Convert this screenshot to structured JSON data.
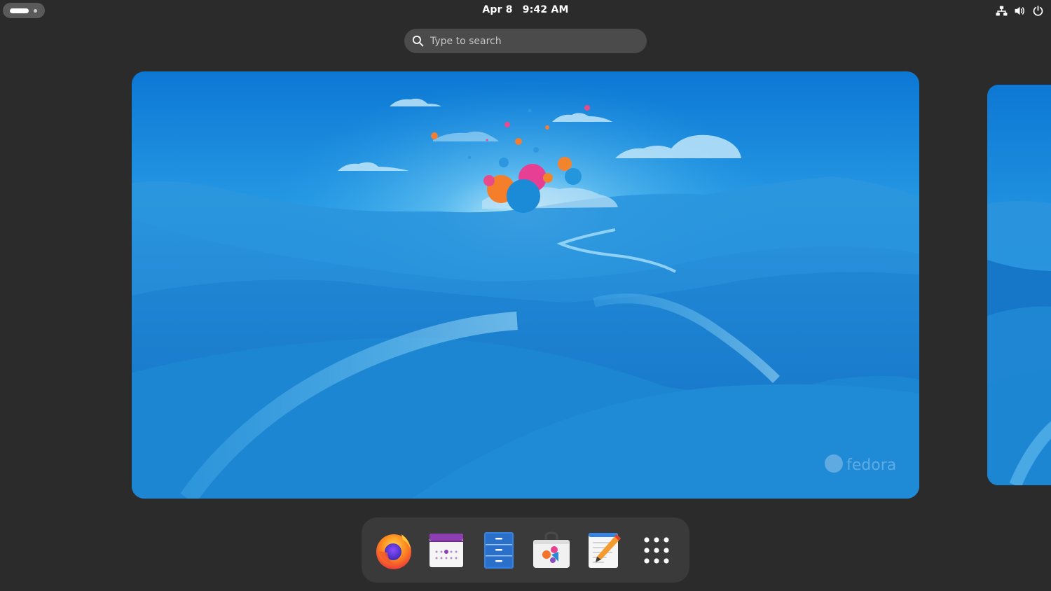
{
  "topbar": {
    "date": "Apr 8",
    "time": "9:42 AM",
    "status_icons": [
      "network-wired-icon",
      "volume-icon",
      "power-icon"
    ]
  },
  "search": {
    "placeholder": "Type to search",
    "value": ""
  },
  "workspace": {
    "wallpaper_watermark": "fedora"
  },
  "dock": {
    "items": [
      {
        "icon": "firefox-icon"
      },
      {
        "icon": "calendar-icon"
      },
      {
        "icon": "files-icon"
      },
      {
        "icon": "software-icon"
      },
      {
        "icon": "text-editor-icon"
      },
      {
        "icon": "show-apps-icon"
      }
    ]
  },
  "colors": {
    "panel_bg": "#2b2b2b",
    "dock_bg": "#3a3a3a",
    "search_bg": "#4b4b4b",
    "wallpaper_sky": "#1b8fe0",
    "wallpaper_hills": "#1274c8"
  }
}
